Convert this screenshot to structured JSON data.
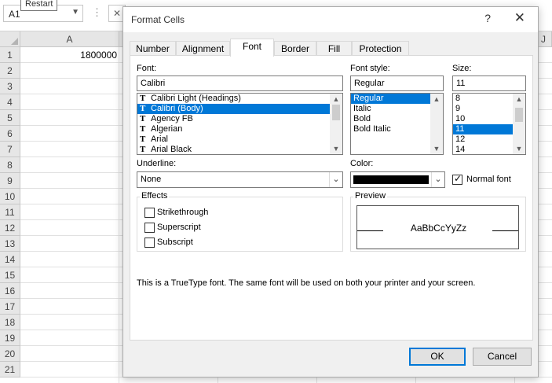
{
  "excel": {
    "tooltip": "Restart",
    "namebox": "A1",
    "fx_dots": "⋮",
    "fx_cancel": "✕",
    "columns": [
      "A",
      "J"
    ],
    "rows": [
      "1",
      "2",
      "3",
      "4",
      "5",
      "6",
      "7",
      "8",
      "9",
      "10",
      "11",
      "12",
      "13",
      "14",
      "15",
      "16",
      "17",
      "18",
      "19",
      "20",
      "21"
    ],
    "cell_a1": "1800000"
  },
  "dialog": {
    "title": "Format Cells",
    "help": "?",
    "close": "✕",
    "tabs": [
      "Number",
      "Alignment",
      "Font",
      "Border",
      "Fill",
      "Protection"
    ],
    "active_tab": "Font",
    "font": {
      "label": "Font:",
      "value": "Calibri",
      "glyph": "T",
      "items": [
        "Calibri Light (Headings)",
        "Calibri (Body)",
        "Agency FB",
        "Algerian",
        "Arial",
        "Arial Black"
      ],
      "selected": "Calibri (Body)"
    },
    "style": {
      "label": "Font style:",
      "value": "Regular",
      "items": [
        "Regular",
        "Italic",
        "Bold",
        "Bold Italic"
      ],
      "selected": "Regular"
    },
    "size": {
      "label": "Size:",
      "value": "11",
      "items": [
        "8",
        "9",
        "10",
        "11",
        "12",
        "14"
      ],
      "selected": "11"
    },
    "underline": {
      "label": "Underline:",
      "value": "None"
    },
    "color": {
      "label": "Color:",
      "value_hex": "#000000"
    },
    "normal_font": {
      "label": "Normal font",
      "checked": true
    },
    "effects": {
      "label": "Effects",
      "strikethrough": "Strikethrough",
      "superscript": "Superscript",
      "subscript": "Subscript"
    },
    "preview": {
      "label": "Preview",
      "text": "AaBbCcYyZz"
    },
    "info": "This is a TrueType font.  The same font will be used on both your printer and your screen.",
    "ok": "OK",
    "cancel": "Cancel"
  },
  "colors": {
    "selection": "#0078d7",
    "dialog_bg": "#f0f0f0"
  }
}
